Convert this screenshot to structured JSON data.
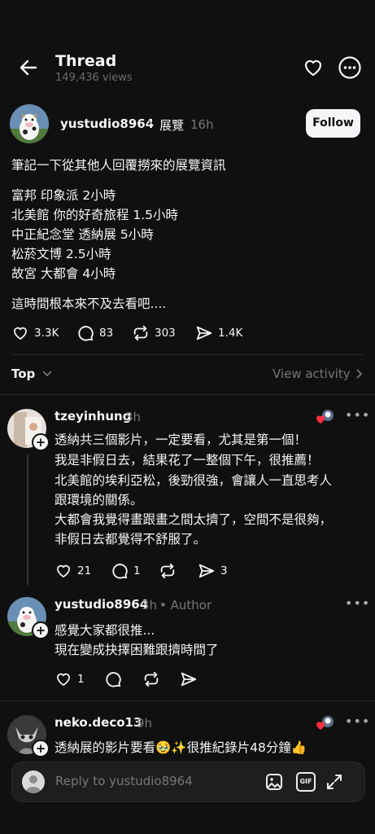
{
  "header": {
    "title": "Thread",
    "views": "149,436 views"
  },
  "post": {
    "author": "yustudio8964",
    "chevron": "›",
    "tag": "展覽",
    "time": "16h",
    "follow_label": "Follow",
    "lines": [
      "筆記一下從其他人回覆撈來的展覽資訊",
      "富邦 印象派 2小時",
      "北美館 你的好奇旅程 1.5小時",
      "中正紀念堂 透納展 5小時",
      "松菸文博 2.5小時",
      "故宮 大都會 4小時",
      "這時間根本來不及去看吧...."
    ],
    "stats": {
      "likes": "3.3K",
      "comments": "83",
      "reposts": "303",
      "shares": "1.4K"
    }
  },
  "filter": {
    "sort_label": "Top",
    "view_activity": "View activity"
  },
  "replies": [
    {
      "author": "tzeyinhung",
      "time": "3h",
      "lines": [
        "透納共三個影片，一定要看，尤其是第一個！",
        "我是非假日去，結果花了一整個下午，很推薦！",
        "北美館的埃利亞松，後勁很強，會讓人一直思考人",
        "跟環境的關係。",
        "大都會我覺得畫跟畫之間太擠了，空間不是很夠，",
        "非假日去都覺得不舒服了。"
      ],
      "likes": "21",
      "comments": "1",
      "shares": "3"
    },
    {
      "author": "yustudio8964",
      "time": "3h",
      "badge": "• Author",
      "lines": [
        "感覺大家都很推...",
        "現在變成抉擇困難跟擠時間了"
      ],
      "likes": "1"
    },
    {
      "author": "neko.deco13",
      "time": "9h",
      "lines": [
        "透納展的影片要看🥹✨很推紀錄片48分鐘👍"
      ]
    }
  ],
  "composer": {
    "placeholder": "Reply to yustudio8964"
  },
  "colors": {
    "background": "#101010",
    "text": "#f3f5f7",
    "muted": "#777777",
    "liked_heart": "#ff3040"
  },
  "icons": [
    "back-arrow-icon",
    "heart-icon",
    "more-icon",
    "comment-icon",
    "repost-icon",
    "share-icon",
    "chevron-down-icon",
    "chevron-right-icon",
    "image-icon",
    "gif-icon",
    "expand-icon"
  ]
}
